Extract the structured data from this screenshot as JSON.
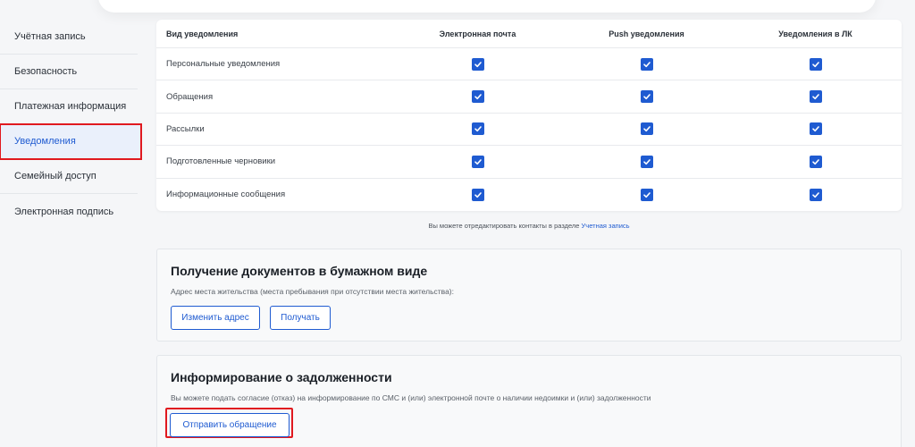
{
  "sidebar": {
    "items": [
      {
        "label": "Учётная запись"
      },
      {
        "label": "Безопасность"
      },
      {
        "label": "Платежная информация"
      },
      {
        "label": "Уведомления"
      },
      {
        "label": "Семейный доступ"
      },
      {
        "label": "Электронная подпись"
      }
    ],
    "active_index": 3
  },
  "notifications_table": {
    "headers": [
      "Вид уведомления",
      "Электронная почта",
      "Push уведомления",
      "Уведомления в ЛК"
    ],
    "rows": [
      {
        "label": "Персональные уведомления",
        "email": true,
        "push": true,
        "lk": true
      },
      {
        "label": "Обращения",
        "email": true,
        "push": true,
        "lk": true
      },
      {
        "label": "Рассылки",
        "email": true,
        "push": true,
        "lk": true
      },
      {
        "label": "Подготовленные черновики",
        "email": true,
        "push": true,
        "lk": true
      },
      {
        "label": "Информационные сообщения",
        "email": true,
        "push": true,
        "lk": true
      }
    ]
  },
  "note": {
    "text": "Вы можете отредактировать контакты в разделе ",
    "link": "Учетная запись"
  },
  "paper_docs": {
    "title": "Получение документов в бумажном виде",
    "description": "Адрес места жительства (места пребывания при отсутствии места жительства):",
    "change_address_label": "Изменить адрес",
    "receive_label": "Получать"
  },
  "debt_info": {
    "title": "Информирование о задолженности",
    "description": "Вы можете подать согласие (отказ) на информирование по СМС и (или) электронной почте о наличии недоимки и (или) задолженности",
    "send_request_label": "Отправить обращение"
  },
  "colors": {
    "accent": "#1f5bd1",
    "highlight": "#e0191f"
  },
  "icons": {
    "checkbox": "check-icon"
  }
}
